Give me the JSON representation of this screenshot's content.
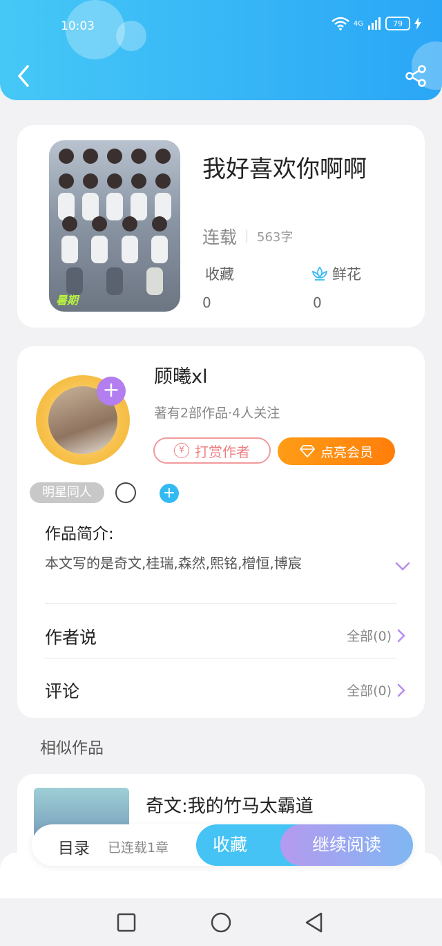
{
  "status_bar": {
    "time": "10:03",
    "network": "4G",
    "battery": "79"
  },
  "header": {
    "back_label": "back",
    "share_label": "share"
  },
  "book": {
    "title": "我好喜欢你啊啊",
    "status": "连载",
    "word_count": "563字",
    "favorites_label": "收藏",
    "favorites_value": "0",
    "flowers_label": "鲜花",
    "flowers_value": "0",
    "cover_tag": "暑期"
  },
  "author": {
    "name": "顾曦xl",
    "meta": "著有2部作品·4人关注",
    "tip_button": "打赏作者",
    "tip_icon": "¥",
    "vip_button": "点亮会员",
    "tag": "明星同人",
    "intro_label": "作品简介:",
    "intro_text": "本文写的是奇文,桂瑞,森然,熙铭,橧恒,博宸",
    "author_says_label": "作者说",
    "author_says_count": "全部(0)",
    "comments_label": "评论",
    "comments_count": "全部(0)"
  },
  "similar": {
    "section_title": "相似作品",
    "items": [
      {
        "title": "奇文:我的竹马太霸道"
      }
    ]
  },
  "action_bar": {
    "toc": "目录",
    "toc_status": "已连载1章",
    "favorite": "收藏",
    "continue_reading": "继续阅读"
  },
  "colors": {
    "header": "#2aa6f6",
    "accent_purple": "#b37ef0",
    "vip_orange": "#ff8a0f",
    "tip_red": "#ef7d80"
  }
}
